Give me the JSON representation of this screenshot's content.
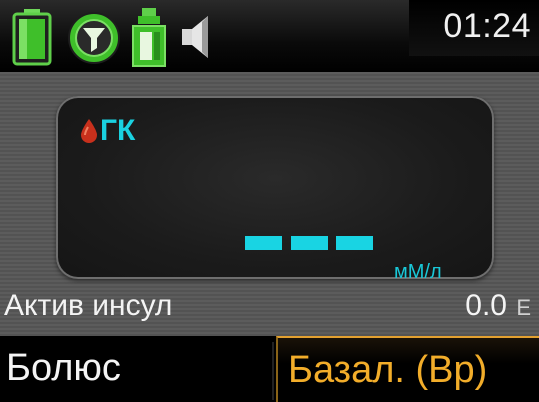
{
  "status_bar": {
    "icons": [
      "battery-icon",
      "cgm-sensor-icon",
      "reservoir-icon",
      "sound-icon"
    ],
    "time": "01:24"
  },
  "bg_panel": {
    "label": "ГК",
    "value": "---",
    "unit": "мМ/л"
  },
  "active_insulin": {
    "label": "Актив инсул",
    "value": "0.0",
    "unit": "Е"
  },
  "softkeys": {
    "left_label": "Болюс",
    "right_label": "Базал. (Вр)"
  },
  "colors": {
    "accent_cyan": "#19d4e3",
    "softkey_orange": "#f2ad2a",
    "battery_green": "#3fbf2a",
    "drop_red": "#c8301c"
  }
}
